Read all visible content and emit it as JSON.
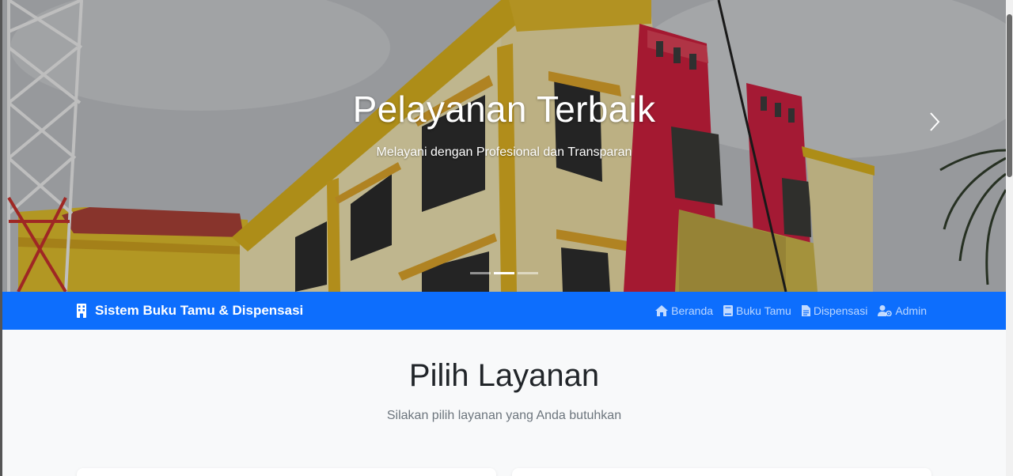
{
  "hero": {
    "title": "Pelayanan Terbaik",
    "subtitle": "Melayani dengan Profesional dan Transparan",
    "slide_count": 3,
    "active_slide": 2
  },
  "navbar": {
    "brand": "Sistem Buku Tamu & Dispensasi",
    "brand_icon": "building-icon",
    "color": "#0d6efd",
    "links": [
      {
        "label": "Beranda",
        "icon": "home-icon"
      },
      {
        "label": "Buku Tamu",
        "icon": "book-icon"
      },
      {
        "label": "Dispensasi",
        "icon": "file-icon"
      },
      {
        "label": "Admin",
        "icon": "user-cog-icon"
      }
    ]
  },
  "main": {
    "title": "Pilih Layanan",
    "subtitle": "Silakan pilih layanan yang Anda butuhkan"
  }
}
